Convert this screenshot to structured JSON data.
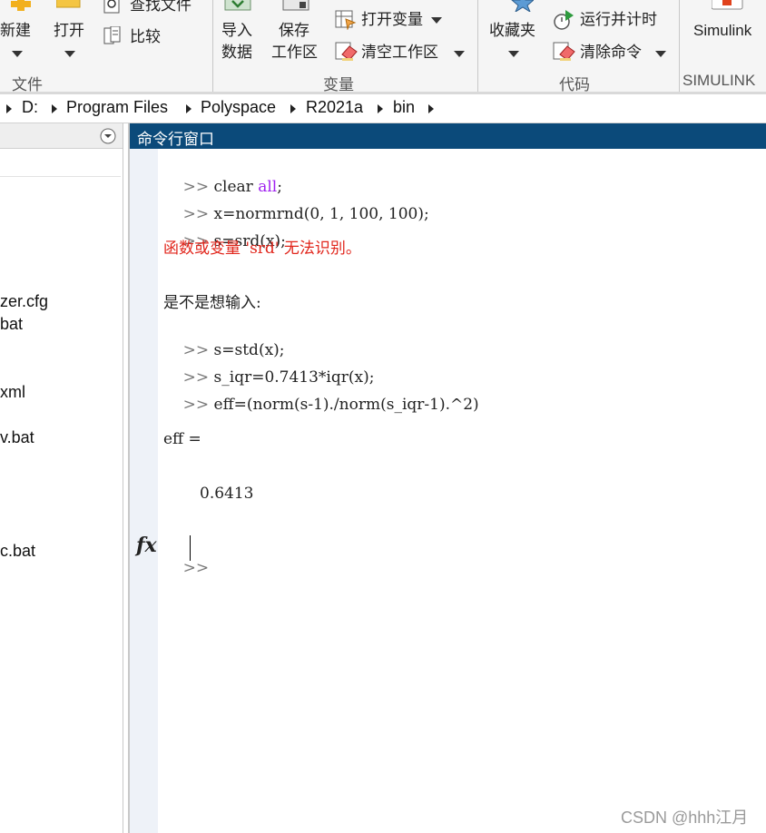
{
  "ribbon": {
    "file_section": {
      "label": "文件",
      "new_label": "新建",
      "open_label": "打开",
      "find_files_label": "查找文件",
      "compare_label": "比较"
    },
    "variable_section": {
      "label": "变量",
      "import_label_1": "导入",
      "import_label_2": "数据",
      "save_label_1": "保存",
      "save_label_2": "工作区",
      "open_var_label": "打开变量",
      "clear_ws_label": "清空工作区"
    },
    "code_section": {
      "label": "代码",
      "favorites_label": "收藏夹",
      "run_time_label": "运行并计时",
      "clear_cmd_label": "清除命令"
    },
    "simulink_section": {
      "label": "SIMULINK",
      "simulink_label": "Simulink"
    }
  },
  "address": {
    "crumbs": [
      "D:",
      "Program Files",
      "Polyspace",
      "R2021a",
      "bin"
    ]
  },
  "files": [
    "zer.cfg",
    "bat",
    "xml",
    "v.bat",
    "c.bat"
  ],
  "command_window": {
    "title": "命令行窗口",
    "prompt": ">>",
    "lines": {
      "l1_cmd": "clear ",
      "l1_kw": "all",
      "l1_end": ";",
      "l2": "x=normrnd(0, 1, 100, 100);",
      "l3": "s=srd(x);",
      "err": "函数或变量 'srd' 无法识别。",
      "suggest": "是不是想输入:",
      "l4": "s=std(x);",
      "l5": "s_iqr=0.7413*iqr(x);",
      "l6": "eff=(norm(s-1)./norm(s_iqr-1).^2)",
      "result_name": "eff =",
      "result_value": "0.6413"
    },
    "fx_label": "fx"
  },
  "watermark": "CSDN @hhh江月",
  "colors": {
    "title_bar": "#0b4a7a",
    "error": "#e1251b",
    "keyword": "#a020f0"
  }
}
